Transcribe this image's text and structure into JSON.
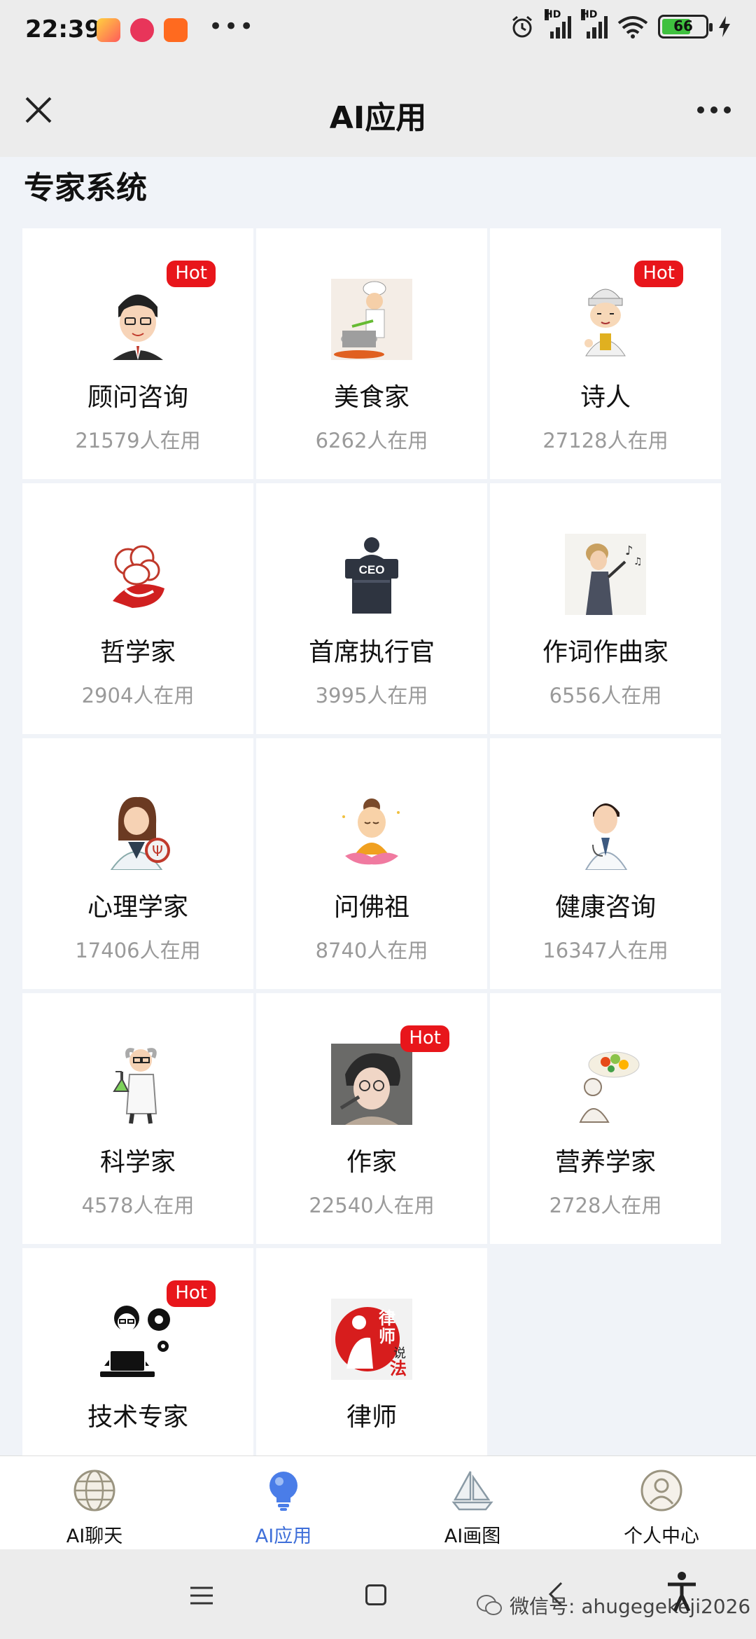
{
  "status": {
    "time": "22:39",
    "hd1": "HD",
    "hd2": "HD",
    "battery": "66"
  },
  "header": {
    "title": "AI应用"
  },
  "section": {
    "title": "专家系统"
  },
  "cards": [
    {
      "name": "顾问咨询",
      "count": "21579人在用",
      "hot": "Hot"
    },
    {
      "name": "美食家",
      "count": "6262人在用"
    },
    {
      "name": "诗人",
      "count": "27128人在用",
      "hot": "Hot"
    },
    {
      "name": "哲学家",
      "count": "2904人在用"
    },
    {
      "name": "首席执行官",
      "count": "3995人在用",
      "img_text": "CEO"
    },
    {
      "name": "作词作曲家",
      "count": "6556人在用"
    },
    {
      "name": "心理学家",
      "count": "17406人在用"
    },
    {
      "name": "问佛祖",
      "count": "8740人在用"
    },
    {
      "name": "健康咨询",
      "count": "16347人在用"
    },
    {
      "name": "科学家",
      "count": "4578人在用"
    },
    {
      "name": "作家",
      "count": "22540人在用",
      "hot": "Hot"
    },
    {
      "name": "营养学家",
      "count": "2728人在用"
    },
    {
      "name": "技术专家",
      "count": "",
      "hot": "Hot"
    },
    {
      "name": "律师",
      "count": "",
      "img_text": "律师说法"
    }
  ],
  "tabs": [
    {
      "label": "AI聊天",
      "icon": "globe-icon"
    },
    {
      "label": "AI应用",
      "icon": "lightbulb-icon",
      "active": true
    },
    {
      "label": "AI画图",
      "icon": "sailboat-icon"
    },
    {
      "label": "个人中心",
      "icon": "user-icon"
    }
  ],
  "watermark": "微信号: ahugegekeji2026",
  "colors": {
    "hot_badge": "#e8161b",
    "active_tab": "#3f6fd9",
    "battery_fill": "#3fc13f"
  },
  "battery_level": 0.66
}
